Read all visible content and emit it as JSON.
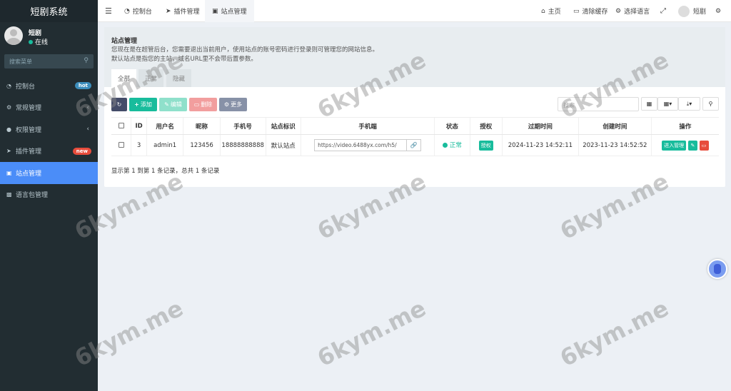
{
  "sidebar": {
    "app_title": "短剧系统",
    "user": {
      "name": "短剧",
      "status": "在线"
    },
    "search_placeholder": "搜索菜单",
    "items": [
      {
        "icon": "dashboard-icon",
        "label": "控制台",
        "badge": "hot"
      },
      {
        "icon": "cogs-icon",
        "label": "常规管理"
      },
      {
        "icon": "group-icon",
        "label": "权限管理"
      },
      {
        "icon": "rocket-icon",
        "label": "插件管理",
        "badge": "new"
      },
      {
        "icon": "bank-icon",
        "label": "站点管理"
      },
      {
        "icon": "language-icon",
        "label": "语言包管理"
      }
    ]
  },
  "topbar": {
    "tabs": [
      {
        "icon": "dashboard-icon",
        "label": "控制台"
      },
      {
        "icon": "rocket-icon",
        "label": "插件管理"
      },
      {
        "icon": "bank-icon",
        "label": "站点管理"
      }
    ],
    "home": "主页",
    "clear_cache": "清除缓存",
    "language": "选择语言",
    "username": "短剧"
  },
  "panel": {
    "title": "站点管理",
    "desc_line1": "您现在是在超管后台，您需要退出当前用户，使用站点的账号密码进行登录则可管理您的网站信息。",
    "desc_line2": "默认站点是指您的主站，域名URL里不会带后置参数。",
    "tabs": [
      "全部",
      "正常",
      "隐藏"
    ],
    "toolbar": {
      "add": "添加",
      "edit": "编辑",
      "delete": "删除",
      "more": "更多",
      "search_placeholder": "搜索"
    },
    "table": {
      "columns": [
        "ID",
        "用户名",
        "昵称",
        "手机号",
        "站点标识",
        "手机端",
        "状态",
        "授权",
        "过期时间",
        "创建时间",
        "操作"
      ],
      "rows": [
        {
          "id": "3",
          "username": "admin1",
          "nickname": "123456",
          "phone": "18888888888",
          "site_tag": "默认站点",
          "mobile_url": "https://video.6488yx.com/h5/",
          "status": "正常",
          "auth": "授权",
          "expire": "2024-11-23 14:52:11",
          "created": "2023-11-23 14:52:52",
          "enter_label": "进入管理"
        }
      ]
    },
    "pager": "显示第 1 到第 1 条记录，总共 1 条记录"
  },
  "watermark": "6kym.me",
  "colors": {
    "sidebar": "#222d32",
    "active": "#4b8df8",
    "green": "#18bc9c",
    "red": "#e74c3c",
    "dark": "#444c69"
  }
}
